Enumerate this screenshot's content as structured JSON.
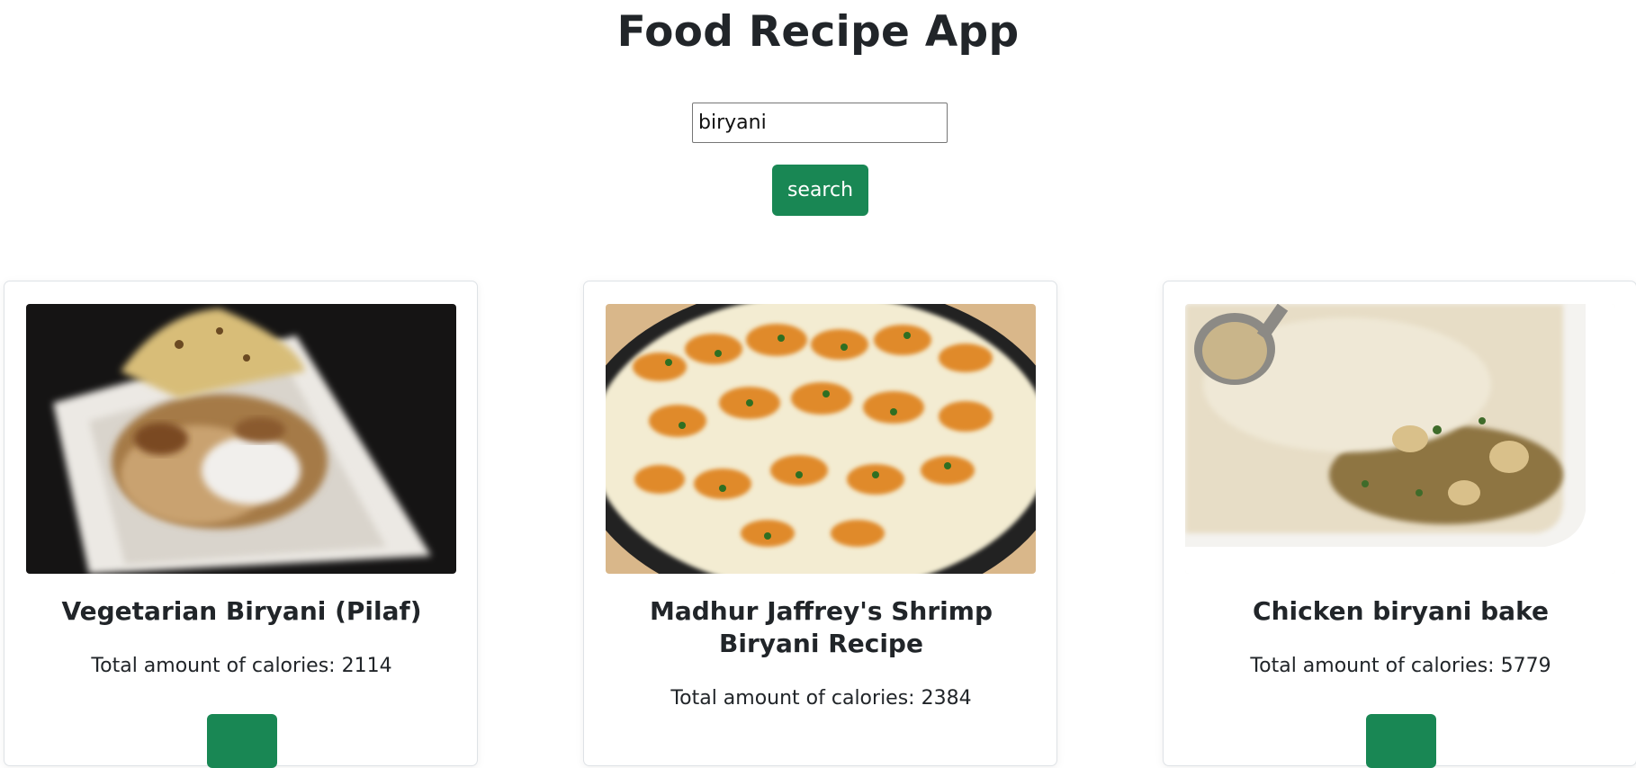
{
  "app": {
    "title": "Food Recipe App"
  },
  "search": {
    "value": "biryani",
    "button_label": "search"
  },
  "recipes": [
    {
      "title": "Vegetarian Biryani (Pilaf)",
      "calories_text": "Total amount of calories: 2114",
      "calories": 2114,
      "button_label": ""
    },
    {
      "title": "Madhur Jaffrey's Shrimp Biryani Recipe",
      "calories_text": "Total amount of calories: 2384",
      "calories": 2384,
      "button_label": ""
    },
    {
      "title": "Chicken biryani bake",
      "calories_text": "Total amount of calories: 5779",
      "calories": 5779,
      "button_label": ""
    }
  ],
  "colors": {
    "accent": "#198754",
    "text": "#212529",
    "card_border": "#dee2e6"
  }
}
